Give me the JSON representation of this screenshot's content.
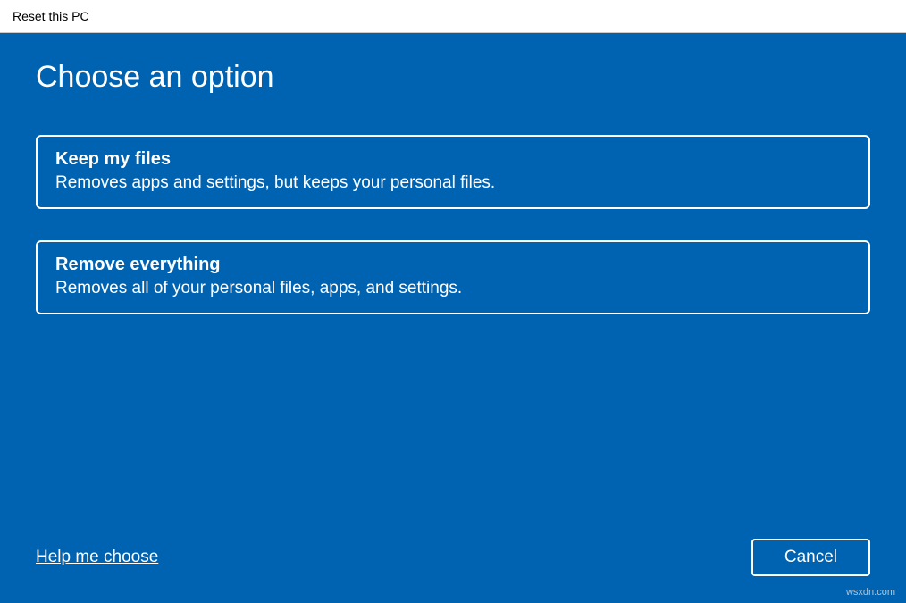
{
  "window": {
    "title": "Reset this PC"
  },
  "page": {
    "heading": "Choose an option"
  },
  "options": {
    "keep": {
      "title": "Keep my files",
      "description": "Removes apps and settings, but keeps your personal files."
    },
    "remove": {
      "title": "Remove everything",
      "description": "Removes all of your personal files, apps, and settings."
    }
  },
  "footer": {
    "help_link": "Help me choose",
    "cancel_label": "Cancel"
  },
  "watermark": "wsxdn.com"
}
